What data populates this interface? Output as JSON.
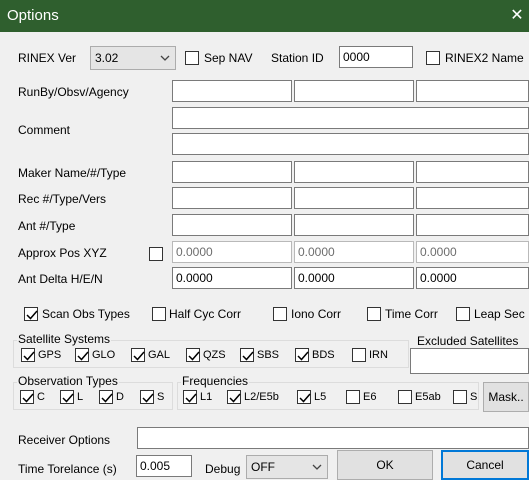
{
  "window": {
    "title": "Options",
    "close_glyph": "✕"
  },
  "rinex": {
    "version_label": "RINEX Ver",
    "version_value": "3.02",
    "sep_nav_label": "Sep NAV",
    "station_id_label": "Station ID",
    "station_id_value": "0000",
    "rinex2_name_label": "RINEX2 Name"
  },
  "header_fields": {
    "runby_label": "RunBy/Obsv/Agency",
    "comment_label": "Comment",
    "maker_label": "Maker Name/#/Type",
    "rec_label": "Rec #/Type/Vers",
    "ant_label": "Ant #/Type",
    "approx_pos_label": "Approx Pos XYZ",
    "approx_pos_values": [
      "0.0000",
      "0.0000",
      "0.0000"
    ],
    "ant_delta_label": "Ant Delta H/E/N",
    "ant_delta_values": [
      "0.0000",
      "0.0000",
      "0.0000"
    ]
  },
  "options": {
    "scan_obs_label": "Scan Obs Types",
    "half_cyc_label": "Half Cyc Corr",
    "iono_label": "Iono Corr",
    "time_corr_label": "Time Corr",
    "leap_sec_label": "Leap Sec"
  },
  "satellite_systems": {
    "title": "Satellite Systems",
    "items": [
      {
        "label": "GPS",
        "checked": true
      },
      {
        "label": "GLO",
        "checked": true
      },
      {
        "label": "GAL",
        "checked": true
      },
      {
        "label": "QZS",
        "checked": true
      },
      {
        "label": "SBS",
        "checked": true
      },
      {
        "label": "BDS",
        "checked": true
      },
      {
        "label": "IRN",
        "checked": false
      }
    ],
    "excluded_label": "Excluded Satellites"
  },
  "observation_types": {
    "title": "Observation Types",
    "items": [
      {
        "label": "C",
        "checked": true
      },
      {
        "label": "L",
        "checked": true
      },
      {
        "label": "D",
        "checked": true
      },
      {
        "label": "S",
        "checked": true
      }
    ]
  },
  "frequencies": {
    "title": "Frequencies",
    "items": [
      {
        "label": "L1",
        "checked": true
      },
      {
        "label": "L2/E5b",
        "checked": true
      },
      {
        "label": "L5",
        "checked": true
      },
      {
        "label": "E6",
        "checked": false
      },
      {
        "label": "E5ab",
        "checked": false
      },
      {
        "label": "S",
        "checked": false
      }
    ],
    "mask_label": "Mask.."
  },
  "receiver_options": {
    "label": "Receiver Options",
    "value": ""
  },
  "footer": {
    "time_tolerance_label": "Time Torelance (s)",
    "time_tolerance_value": "0.005",
    "debug_label": "Debug",
    "debug_value": "OFF",
    "ok_label": "OK",
    "cancel_label": "Cancel"
  }
}
